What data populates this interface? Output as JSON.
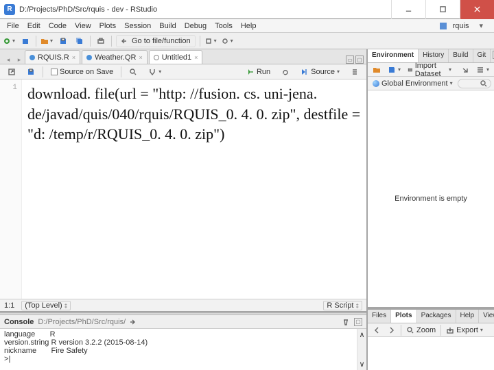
{
  "window": {
    "title": "D:/Projects/PhD/Src/rquis - dev - RStudio",
    "app_icon_letter": "R"
  },
  "menu": [
    "File",
    "Edit",
    "Code",
    "View",
    "Plots",
    "Session",
    "Build",
    "Debug",
    "Tools",
    "Help"
  ],
  "project_name": "rquis",
  "goto_placeholder": "Go to file/function",
  "editor": {
    "tabs": [
      {
        "label": "RQUIS.R",
        "icon": "r"
      },
      {
        "label": "Weather.QR",
        "icon": "r"
      },
      {
        "label": "Untitled1",
        "icon": "t",
        "active": true
      }
    ],
    "toolbar": {
      "source_on_save": "Source on Save",
      "run": "Run",
      "source": "Source"
    },
    "gutter": "1",
    "code_text": "download. file(url = \"http: //fusion. cs. uni-jena. de/javad/quis/040/rquis/RQUIS_0. 4. 0. zip\", destfile = \"d: /temp/r/RQUIS_0. 4. 0. zip\")",
    "status": {
      "pos": "1:1",
      "scope": "(Top Level)",
      "lang": "R Script"
    }
  },
  "console": {
    "title": "Console",
    "path": "D:/Projects/PhD/Src/rquis/",
    "lines": [
      "language       R",
      "version.string R version 3.2.2 (2015-08-14)",
      "nickname       Fire Safety",
      ">"
    ]
  },
  "env_pane": {
    "tabs": [
      "Environment",
      "History",
      "Build",
      "Git"
    ],
    "active": 0,
    "toolbar": {
      "import": "Import Dataset"
    },
    "scope": "Global Environment",
    "empty_msg": "Environment is empty"
  },
  "files_pane": {
    "tabs": [
      "Files",
      "Plots",
      "Packages",
      "Help",
      "Viewer"
    ],
    "active": 1,
    "toolbar": {
      "zoom": "Zoom",
      "export": "Export"
    }
  }
}
